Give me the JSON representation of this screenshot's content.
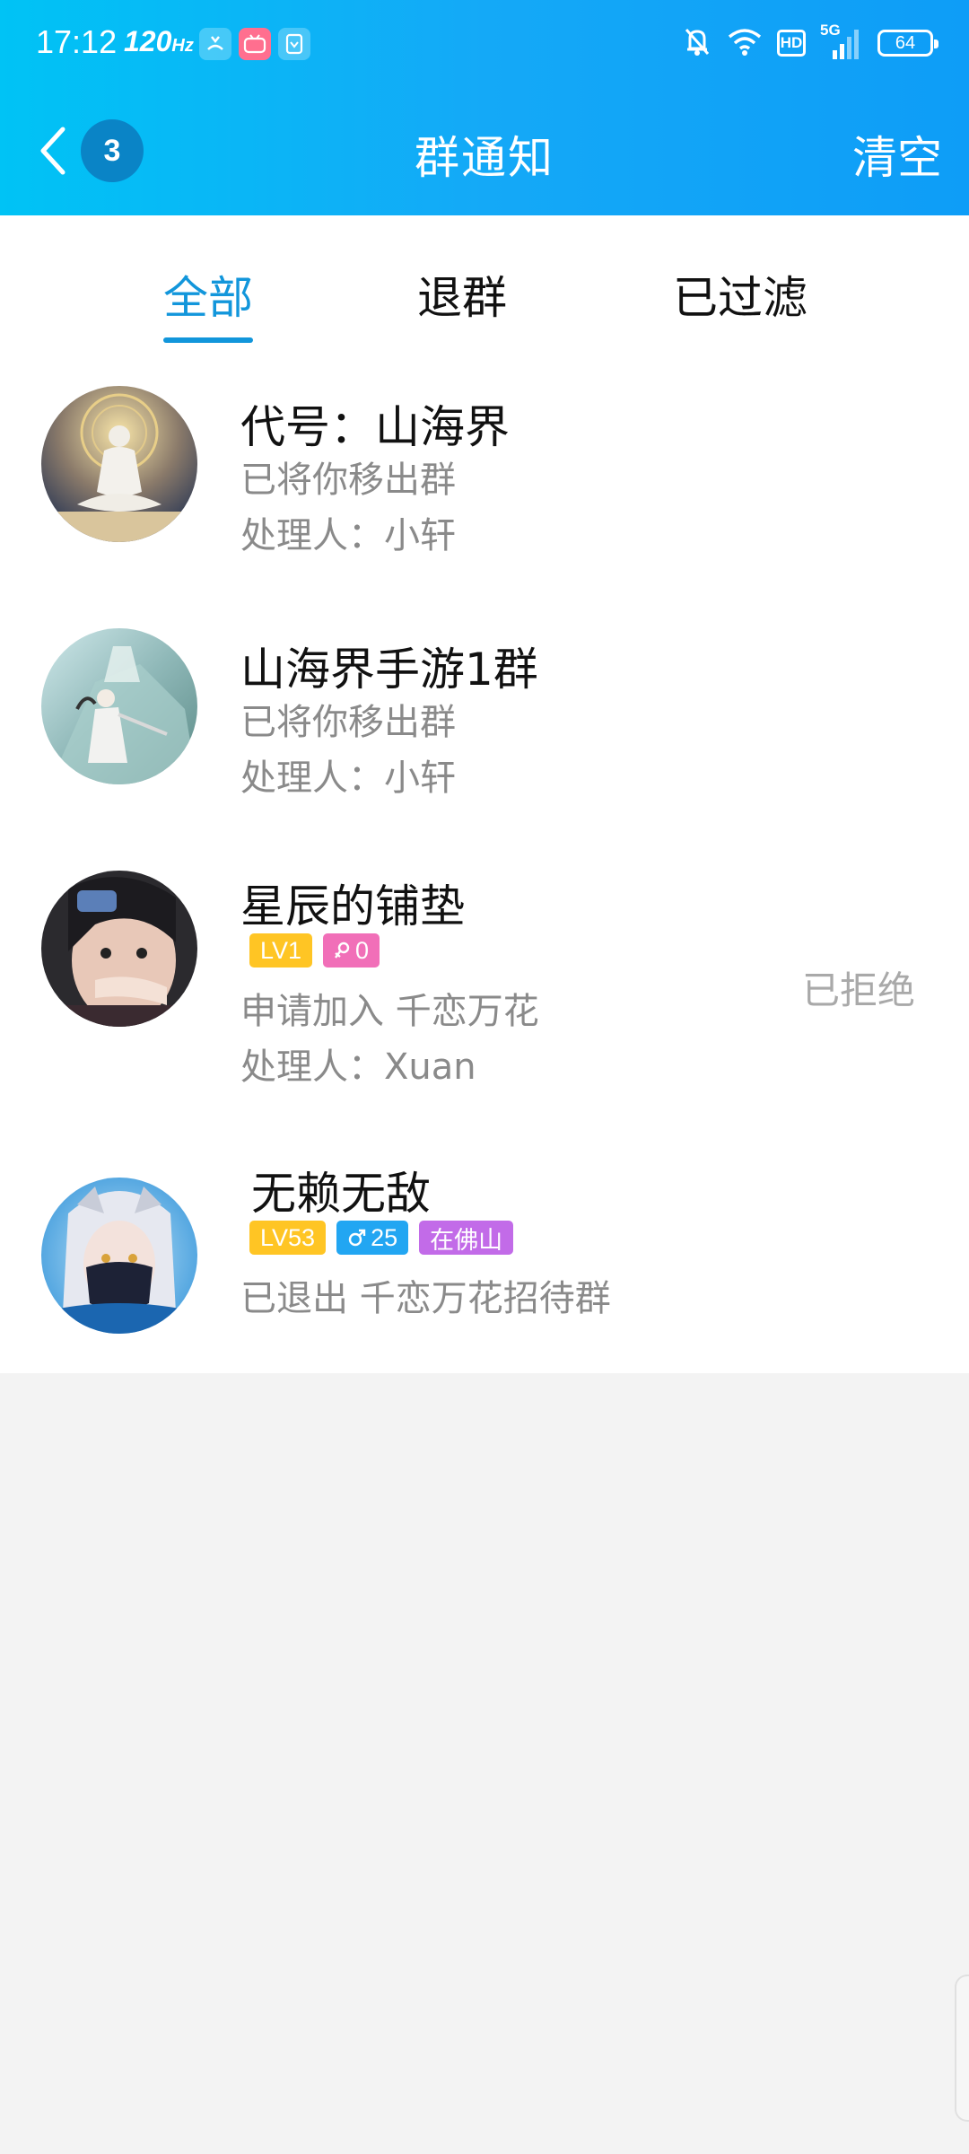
{
  "status_bar": {
    "time": "17:12",
    "refresh_rate": "120",
    "refresh_unit": "Hz",
    "network": "5G",
    "hd": "HD",
    "battery": "64"
  },
  "nav": {
    "unread_count": "3",
    "title": "群通知",
    "clear_label": "清空"
  },
  "tabs": [
    {
      "label": "全部",
      "active": true
    },
    {
      "label": "退群",
      "active": false
    },
    {
      "label": "已过滤",
      "active": false
    }
  ],
  "notifications": [
    {
      "name": "代号：山海界",
      "line1": "已将你移出群",
      "line2": "处理人：小轩"
    },
    {
      "name": "山海界手游1群",
      "line1": "已将你移出群",
      "line2": "处理人：小轩"
    },
    {
      "name": "星辰的铺垫",
      "badges": [
        {
          "text": "LV1",
          "color": "#ffc524"
        },
        {
          "text": "0",
          "color": "#f16fb8",
          "icon": "female-icon"
        }
      ],
      "line1": "申请加入 千恋万花",
      "line2": "处理人：Xuan",
      "status": "已拒绝"
    },
    {
      "name": "无赖无敌",
      "badges": [
        {
          "text": "LV53",
          "color": "#ffc524"
        },
        {
          "text": "25",
          "color": "#22a6f2",
          "icon": "male-icon"
        },
        {
          "text": "在佛山",
          "color": "#c26be8"
        }
      ],
      "line1": "已退出 千恋万花招待群"
    }
  ],
  "colors": {
    "header_start": "#00c3f5",
    "header_end": "#0e9df7",
    "accent": "#1296db",
    "secondary_text": "#8a8a8a"
  }
}
